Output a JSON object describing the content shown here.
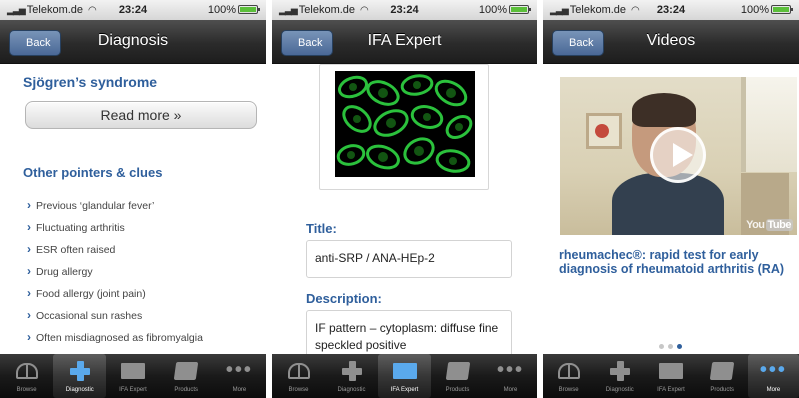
{
  "status": {
    "carrier": "Telekom.de",
    "time": "23:24",
    "battery": "100%"
  },
  "tabs": [
    {
      "label": "Browse",
      "icon": "book-icon"
    },
    {
      "label": "Diagnostic",
      "icon": "cross-icon"
    },
    {
      "label": "IFA Expert",
      "icon": "envelope-icon"
    },
    {
      "label": "Products",
      "icon": "box-icon"
    },
    {
      "label": "More",
      "icon": "more-icon"
    }
  ],
  "screen1": {
    "back_label": "Back",
    "title": "Diagnosis",
    "heading": "Sjögren’s syndrome",
    "read_more": "Read more »",
    "subheading": "Other pointers & clues",
    "clues": [
      "Previous ‘glandular fever’",
      "Fluctuating arthritis",
      "ESR often raised",
      "Drug allergy",
      "Food allergy (joint pain)",
      "Occasional sun rashes",
      "Often misdiagnosed as fibromyalgia"
    ],
    "active_tab": 1
  },
  "screen2": {
    "back_label": "Back",
    "title": "IFA Expert",
    "title_label": "Title:",
    "title_value": "anti-SRP / ANA-HEp-2",
    "description_label": "Description:",
    "description_value": "IF pattern – cytoplasm: diffuse fine speckled positive",
    "active_tab": 2
  },
  "screen3": {
    "back_label": "Back",
    "title": "Videos",
    "video_logo_you": "You",
    "video_logo_tube": "Tube",
    "video_title": "rheumachec®: rapid test for early diagnosis of rheumatoid arthritis (RA)",
    "pager_count": 3,
    "pager_active": 2,
    "active_tab": 4
  },
  "colors": {
    "heading_blue": "#2f5f9c",
    "tab_active_icon": "#5aa9ec",
    "fluorescence_green": "#33cc33"
  }
}
